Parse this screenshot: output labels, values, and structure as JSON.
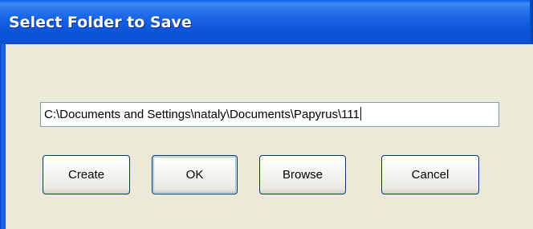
{
  "window": {
    "title": "Select Folder to Save"
  },
  "path_field": {
    "value": "C:\\Documents and Settings\\nataly\\Documents\\Papyrus\\111"
  },
  "buttons": {
    "create_label": "Create",
    "ok_label": "OK",
    "browse_label": "Browse",
    "cancel_label": "Cancel"
  },
  "colors": {
    "titlebar": "#0c55d8",
    "dialog_background": "#ece9d8",
    "button_border": "#003c74"
  }
}
